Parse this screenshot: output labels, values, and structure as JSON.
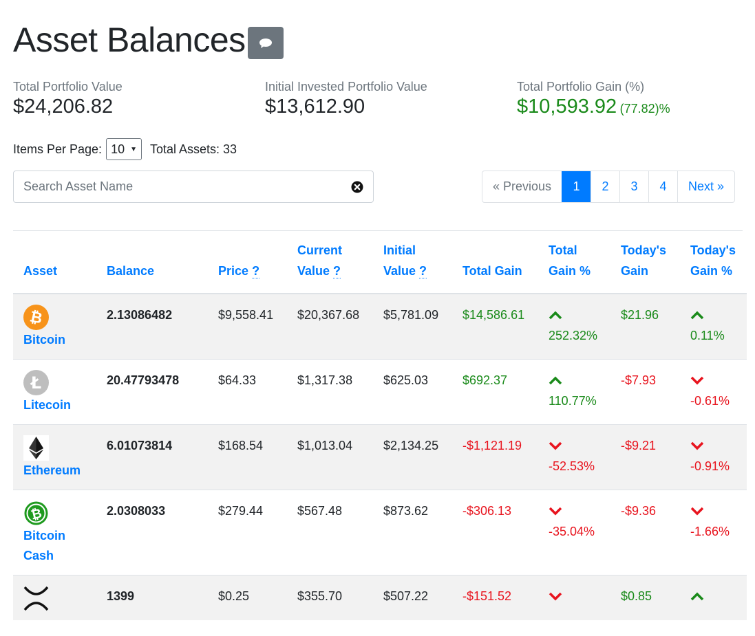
{
  "page": {
    "title": "Asset Balances"
  },
  "summary": {
    "total_value_label": "Total Portfolio Value",
    "total_value": "$24,206.82",
    "initial_label": "Initial Invested Portfolio Value",
    "initial_value": "$13,612.90",
    "gain_label": "Total Portfolio Gain (%)",
    "gain_value": "$10,593.92",
    "gain_pct": "(77.82)%"
  },
  "controls": {
    "items_per_page_label": "Items Per Page:",
    "items_per_page_value": "10",
    "total_assets_label": "Total Assets: 33",
    "search_placeholder": "Search Asset Name"
  },
  "pagination": {
    "previous": "« Previous",
    "pages": [
      "1",
      "2",
      "3",
      "4"
    ],
    "active_page": "1",
    "next": "Next »"
  },
  "table": {
    "headers": {
      "asset": "Asset",
      "balance": "Balance",
      "price": "Price",
      "current_value_1": "Current",
      "current_value_2": "Value",
      "initial_value_1": "Initial",
      "initial_value_2": "Value",
      "total_gain": "Total Gain",
      "total_gain_pct_1": "Total",
      "total_gain_pct_2": "Gain %",
      "todays_gain_1": "Today's",
      "todays_gain_2": "Gain",
      "todays_gain_pct_1": "Today's",
      "todays_gain_pct_2": "Gain %",
      "help_mark": "?"
    },
    "rows": [
      {
        "name": "Bitcoin",
        "icon": "bitcoin-icon",
        "balance": "2.13086482",
        "price": "$9,558.41",
        "current": "$20,367.68",
        "initial": "$5,781.09",
        "total_gain": "$14,586.61",
        "total_gain_pct": "252.32%",
        "todays_gain": "$21.96",
        "todays_gain_pct": "0.11%",
        "total_dir": "up",
        "today_dir": "up"
      },
      {
        "name": "Litecoin",
        "icon": "litecoin-icon",
        "balance": "20.47793478",
        "price": "$64.33",
        "current": "$1,317.38",
        "initial": "$625.03",
        "total_gain": "$692.37",
        "total_gain_pct": "110.77%",
        "todays_gain": "-$7.93",
        "todays_gain_pct": "-0.61%",
        "total_dir": "up",
        "today_dir": "down"
      },
      {
        "name": "Ethereum",
        "icon": "ethereum-icon",
        "balance": "6.01073814",
        "price": "$168.54",
        "current": "$1,013.04",
        "initial": "$2,134.25",
        "total_gain": "-$1,121.19",
        "total_gain_pct": "-52.53%",
        "todays_gain": "-$9.21",
        "todays_gain_pct": "-0.91%",
        "total_dir": "down",
        "today_dir": "down"
      },
      {
        "name_1": "Bitcoin",
        "name_2": "Cash",
        "icon": "bitcoin-cash-icon",
        "balance": "2.0308033",
        "price": "$279.44",
        "current": "$567.48",
        "initial": "$873.62",
        "total_gain": "-$306.13",
        "total_gain_pct": "-35.04%",
        "todays_gain": "-$9.36",
        "todays_gain_pct": "-1.66%",
        "total_dir": "down",
        "today_dir": "down"
      },
      {
        "icon": "ripple-icon",
        "balance": "1399",
        "price": "$0.25",
        "current": "$355.70",
        "initial": "$507.22",
        "total_gain": "-$151.52",
        "todays_gain": "$0.85",
        "total_dir": "down",
        "today_dir": "up"
      }
    ]
  },
  "colors": {
    "link": "#007bff",
    "positive": "#1a8a1a",
    "negative": "#e8141e",
    "muted": "#6c757d"
  }
}
